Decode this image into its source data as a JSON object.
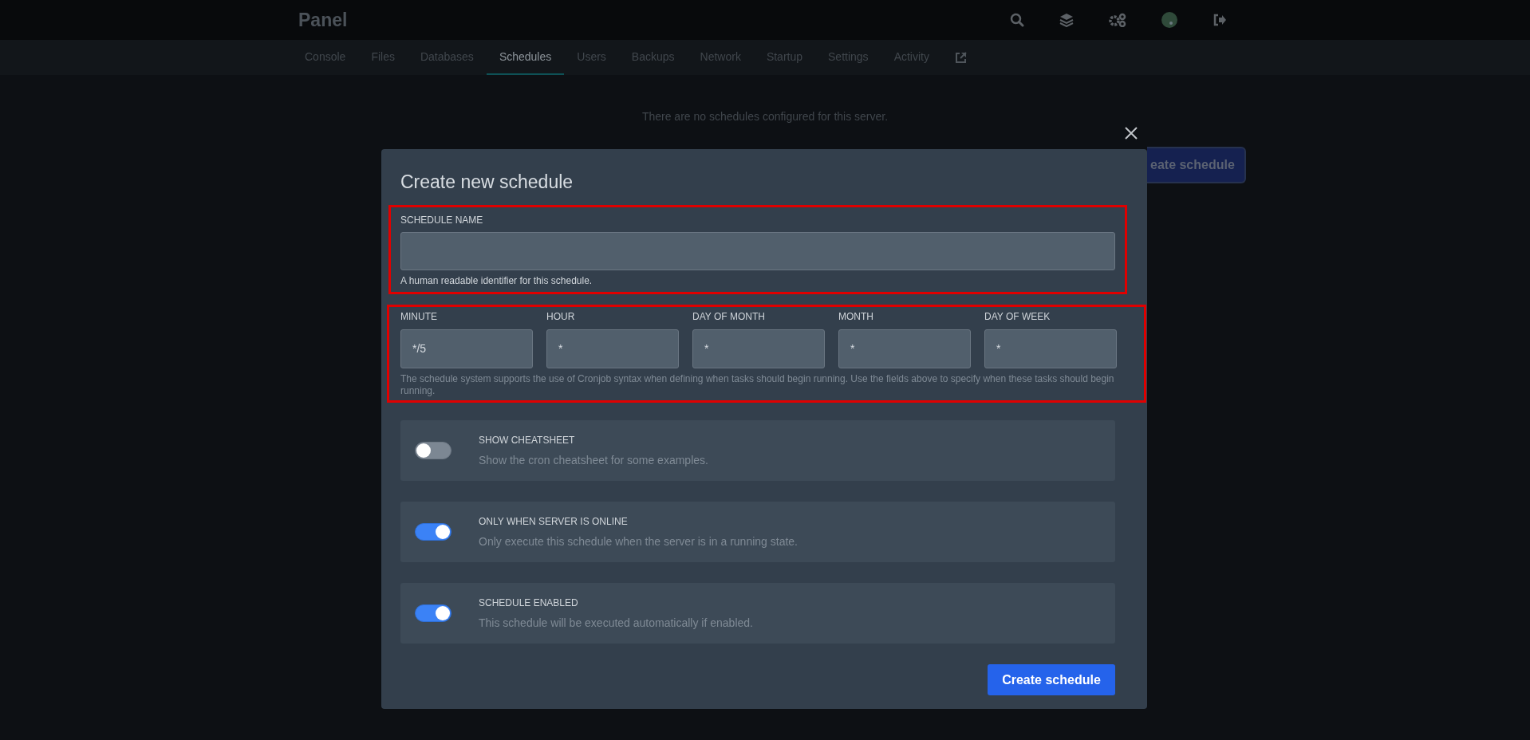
{
  "brand": "Panel",
  "tabs": [
    {
      "label": "Console",
      "selected": false
    },
    {
      "label": "Files",
      "selected": false
    },
    {
      "label": "Databases",
      "selected": false
    },
    {
      "label": "Schedules",
      "selected": true
    },
    {
      "label": "Users",
      "selected": false
    },
    {
      "label": "Backups",
      "selected": false
    },
    {
      "label": "Network",
      "selected": false
    },
    {
      "label": "Startup",
      "selected": false
    },
    {
      "label": "Settings",
      "selected": false
    },
    {
      "label": "Activity",
      "selected": false
    }
  ],
  "empty_message": "There are no schedules configured for this server.",
  "background_button": "eate schedule",
  "modal": {
    "title": "Create new schedule",
    "name_field": {
      "label": "SCHEDULE NAME",
      "help": "A human readable identifier for this schedule."
    },
    "cron_fields": [
      {
        "label": "MINUTE",
        "value": "*/5"
      },
      {
        "label": "HOUR",
        "value": "*"
      },
      {
        "label": "DAY OF MONTH",
        "value": "*"
      },
      {
        "label": "MONTH",
        "value": "*"
      },
      {
        "label": "DAY OF WEEK",
        "value": "*"
      }
    ],
    "cron_help": "The schedule system supports the use of Cronjob syntax when defining when tasks should begin running. Use the fields above to specify when these tasks should begin running.",
    "toggles": [
      {
        "title": "SHOW CHEATSHEET",
        "description": "Show the cron cheatsheet for some examples.",
        "on": false
      },
      {
        "title": "ONLY WHEN SERVER IS ONLINE",
        "description": "Only execute this schedule when the server is in a running state.",
        "on": true
      },
      {
        "title": "SCHEDULE ENABLED",
        "description": "This schedule will be executed automatically if enabled.",
        "on": true
      }
    ],
    "submit": "Create schedule"
  }
}
